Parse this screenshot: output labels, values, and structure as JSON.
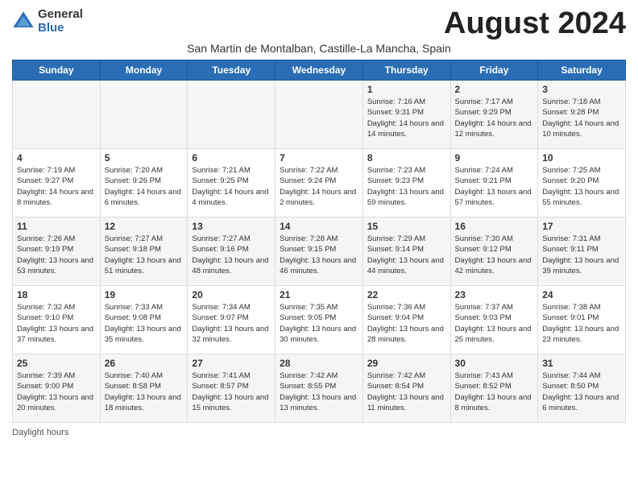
{
  "logo": {
    "general": "General",
    "blue": "Blue"
  },
  "title": "August 2024",
  "subtitle": "San Martin de Montalban, Castille-La Mancha, Spain",
  "days_of_week": [
    "Sunday",
    "Monday",
    "Tuesday",
    "Wednesday",
    "Thursday",
    "Friday",
    "Saturday"
  ],
  "footer": "Daylight hours",
  "weeks": [
    [
      {
        "day": "",
        "info": ""
      },
      {
        "day": "",
        "info": ""
      },
      {
        "day": "",
        "info": ""
      },
      {
        "day": "",
        "info": ""
      },
      {
        "day": "1",
        "info": "Sunrise: 7:16 AM\nSunset: 9:31 PM\nDaylight: 14 hours and 14 minutes."
      },
      {
        "day": "2",
        "info": "Sunrise: 7:17 AM\nSunset: 9:29 PM\nDaylight: 14 hours and 12 minutes."
      },
      {
        "day": "3",
        "info": "Sunrise: 7:18 AM\nSunset: 9:28 PM\nDaylight: 14 hours and 10 minutes."
      }
    ],
    [
      {
        "day": "4",
        "info": "Sunrise: 7:19 AM\nSunset: 9:27 PM\nDaylight: 14 hours and 8 minutes."
      },
      {
        "day": "5",
        "info": "Sunrise: 7:20 AM\nSunset: 9:26 PM\nDaylight: 14 hours and 6 minutes."
      },
      {
        "day": "6",
        "info": "Sunrise: 7:21 AM\nSunset: 9:25 PM\nDaylight: 14 hours and 4 minutes."
      },
      {
        "day": "7",
        "info": "Sunrise: 7:22 AM\nSunset: 9:24 PM\nDaylight: 14 hours and 2 minutes."
      },
      {
        "day": "8",
        "info": "Sunrise: 7:23 AM\nSunset: 9:23 PM\nDaylight: 13 hours and 59 minutes."
      },
      {
        "day": "9",
        "info": "Sunrise: 7:24 AM\nSunset: 9:21 PM\nDaylight: 13 hours and 57 minutes."
      },
      {
        "day": "10",
        "info": "Sunrise: 7:25 AM\nSunset: 9:20 PM\nDaylight: 13 hours and 55 minutes."
      }
    ],
    [
      {
        "day": "11",
        "info": "Sunrise: 7:26 AM\nSunset: 9:19 PM\nDaylight: 13 hours and 53 minutes."
      },
      {
        "day": "12",
        "info": "Sunrise: 7:27 AM\nSunset: 9:18 PM\nDaylight: 13 hours and 51 minutes."
      },
      {
        "day": "13",
        "info": "Sunrise: 7:27 AM\nSunset: 9:16 PM\nDaylight: 13 hours and 48 minutes."
      },
      {
        "day": "14",
        "info": "Sunrise: 7:28 AM\nSunset: 9:15 PM\nDaylight: 13 hours and 46 minutes."
      },
      {
        "day": "15",
        "info": "Sunrise: 7:29 AM\nSunset: 9:14 PM\nDaylight: 13 hours and 44 minutes."
      },
      {
        "day": "16",
        "info": "Sunrise: 7:30 AM\nSunset: 9:12 PM\nDaylight: 13 hours and 42 minutes."
      },
      {
        "day": "17",
        "info": "Sunrise: 7:31 AM\nSunset: 9:11 PM\nDaylight: 13 hours and 39 minutes."
      }
    ],
    [
      {
        "day": "18",
        "info": "Sunrise: 7:32 AM\nSunset: 9:10 PM\nDaylight: 13 hours and 37 minutes."
      },
      {
        "day": "19",
        "info": "Sunrise: 7:33 AM\nSunset: 9:08 PM\nDaylight: 13 hours and 35 minutes."
      },
      {
        "day": "20",
        "info": "Sunrise: 7:34 AM\nSunset: 9:07 PM\nDaylight: 13 hours and 32 minutes."
      },
      {
        "day": "21",
        "info": "Sunrise: 7:35 AM\nSunset: 9:05 PM\nDaylight: 13 hours and 30 minutes."
      },
      {
        "day": "22",
        "info": "Sunrise: 7:36 AM\nSunset: 9:04 PM\nDaylight: 13 hours and 28 minutes."
      },
      {
        "day": "23",
        "info": "Sunrise: 7:37 AM\nSunset: 9:03 PM\nDaylight: 13 hours and 25 minutes."
      },
      {
        "day": "24",
        "info": "Sunrise: 7:38 AM\nSunset: 9:01 PM\nDaylight: 13 hours and 23 minutes."
      }
    ],
    [
      {
        "day": "25",
        "info": "Sunrise: 7:39 AM\nSunset: 9:00 PM\nDaylight: 13 hours and 20 minutes."
      },
      {
        "day": "26",
        "info": "Sunrise: 7:40 AM\nSunset: 8:58 PM\nDaylight: 13 hours and 18 minutes."
      },
      {
        "day": "27",
        "info": "Sunrise: 7:41 AM\nSunset: 8:57 PM\nDaylight: 13 hours and 15 minutes."
      },
      {
        "day": "28",
        "info": "Sunrise: 7:42 AM\nSunset: 8:55 PM\nDaylight: 13 hours and 13 minutes."
      },
      {
        "day": "29",
        "info": "Sunrise: 7:42 AM\nSunset: 8:54 PM\nDaylight: 13 hours and 11 minutes."
      },
      {
        "day": "30",
        "info": "Sunrise: 7:43 AM\nSunset: 8:52 PM\nDaylight: 13 hours and 8 minutes."
      },
      {
        "day": "31",
        "info": "Sunrise: 7:44 AM\nSunset: 8:50 PM\nDaylight: 13 hours and 6 minutes."
      }
    ]
  ]
}
